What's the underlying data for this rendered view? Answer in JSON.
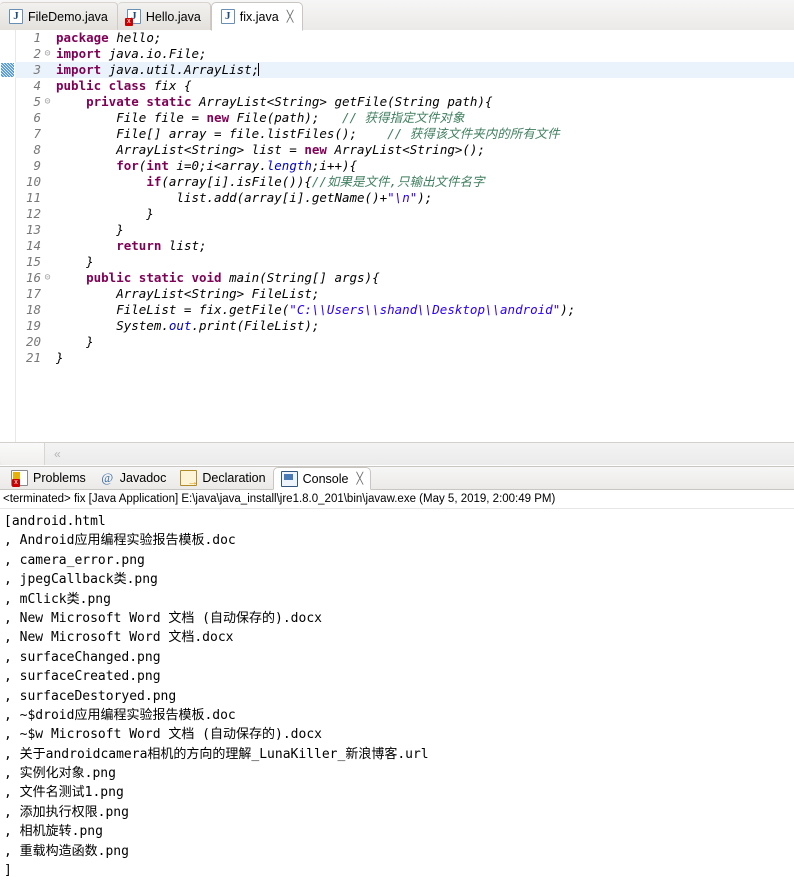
{
  "editor": {
    "tabs": [
      {
        "label": "FileDemo.java",
        "icon": "java-file-icon",
        "active": false,
        "error": false,
        "closeable": false
      },
      {
        "label": "Hello.java",
        "icon": "java-file-error-icon",
        "active": false,
        "error": true,
        "closeable": false
      },
      {
        "label": "fix.java",
        "icon": "java-file-icon",
        "active": true,
        "error": false,
        "closeable": true,
        "close_glyph": "╳"
      }
    ],
    "scroll_chevron": "«",
    "current_line": 3,
    "lines": [
      {
        "num": "1",
        "fold": false,
        "tokens": [
          {
            "t": "package ",
            "c": "kw"
          },
          {
            "t": "hello;",
            "c": "id"
          }
        ]
      },
      {
        "num": "2",
        "fold": true,
        "tokens": [
          {
            "t": "import ",
            "c": "kw"
          },
          {
            "t": "java.io.File;",
            "c": "id"
          }
        ]
      },
      {
        "num": "3",
        "fold": false,
        "tokens": [
          {
            "t": "import ",
            "c": "kw"
          },
          {
            "t": "java.util.ArrayList;",
            "c": "id"
          }
        ],
        "caret": true
      },
      {
        "num": "4",
        "fold": false,
        "tokens": [
          {
            "t": "public class ",
            "c": "kw"
          },
          {
            "t": "fix ",
            "c": "id"
          },
          {
            "t": "{",
            "c": "nrm"
          }
        ]
      },
      {
        "num": "5",
        "fold": true,
        "tokens": [
          {
            "t": "    ",
            "c": "nrm"
          },
          {
            "t": "private static ",
            "c": "kw"
          },
          {
            "t": "ArrayList<String> getFile(String path){",
            "c": "id"
          }
        ]
      },
      {
        "num": "6",
        "fold": false,
        "tokens": [
          {
            "t": "        File file = ",
            "c": "id"
          },
          {
            "t": "new ",
            "c": "kw"
          },
          {
            "t": "File(path);   ",
            "c": "id"
          },
          {
            "t": "// 获得指定文件对象",
            "c": "cmt"
          }
        ]
      },
      {
        "num": "7",
        "fold": false,
        "tokens": [
          {
            "t": "        File[] array = file.listFiles();    ",
            "c": "id"
          },
          {
            "t": "// 获得该文件夹内的所有文件",
            "c": "cmt"
          }
        ]
      },
      {
        "num": "8",
        "fold": false,
        "tokens": [
          {
            "t": "        ArrayList<String> list = ",
            "c": "id"
          },
          {
            "t": "new ",
            "c": "kw"
          },
          {
            "t": "ArrayList<String>();",
            "c": "id"
          }
        ]
      },
      {
        "num": "9",
        "fold": false,
        "tokens": [
          {
            "t": "        ",
            "c": "nrm"
          },
          {
            "t": "for",
            "c": "kw"
          },
          {
            "t": "(",
            "c": "id"
          },
          {
            "t": "int",
            "c": "kw"
          },
          {
            "t": " i=0;i<array.",
            "c": "id"
          },
          {
            "t": "length",
            "c": "fld"
          },
          {
            "t": ";i++){",
            "c": "id"
          }
        ]
      },
      {
        "num": "10",
        "fold": false,
        "tokens": [
          {
            "t": "            ",
            "c": "nrm"
          },
          {
            "t": "if",
            "c": "kw"
          },
          {
            "t": "(array[i].isFile()){",
            "c": "id"
          },
          {
            "t": "//如果是文件,只输出文件名字",
            "c": "cmt"
          }
        ]
      },
      {
        "num": "11",
        "fold": false,
        "tokens": [
          {
            "t": "                list.add(array[i].getName()+",
            "c": "id"
          },
          {
            "t": "\"\\n\"",
            "c": "str"
          },
          {
            "t": ");",
            "c": "id"
          }
        ]
      },
      {
        "num": "12",
        "fold": false,
        "tokens": [
          {
            "t": "            }",
            "c": "nrm"
          }
        ]
      },
      {
        "num": "13",
        "fold": false,
        "tokens": [
          {
            "t": "        }",
            "c": "nrm"
          }
        ]
      },
      {
        "num": "14",
        "fold": false,
        "tokens": [
          {
            "t": "        ",
            "c": "nrm"
          },
          {
            "t": "return ",
            "c": "kw"
          },
          {
            "t": "list;",
            "c": "id"
          }
        ]
      },
      {
        "num": "15",
        "fold": false,
        "tokens": [
          {
            "t": "    }",
            "c": "nrm"
          }
        ]
      },
      {
        "num": "16",
        "fold": true,
        "tokens": [
          {
            "t": "    ",
            "c": "nrm"
          },
          {
            "t": "public static void ",
            "c": "kw"
          },
          {
            "t": "main(String[] args){",
            "c": "id"
          }
        ]
      },
      {
        "num": "17",
        "fold": false,
        "tokens": [
          {
            "t": "        ArrayList<String> FileList;",
            "c": "id"
          }
        ]
      },
      {
        "num": "18",
        "fold": false,
        "tokens": [
          {
            "t": "        FileList = fix.getFile(",
            "c": "id"
          },
          {
            "t": "\"C:\\\\Users\\\\shand\\\\Desktop\\\\android\"",
            "c": "str"
          },
          {
            "t": ");",
            "c": "id"
          }
        ]
      },
      {
        "num": "19",
        "fold": false,
        "tokens": [
          {
            "t": "        System.",
            "c": "id"
          },
          {
            "t": "out",
            "c": "fld"
          },
          {
            "t": ".print(FileList);",
            "c": "id"
          }
        ]
      },
      {
        "num": "20",
        "fold": false,
        "tokens": [
          {
            "t": "    }",
            "c": "nrm"
          }
        ]
      },
      {
        "num": "21",
        "fold": false,
        "tokens": [
          {
            "t": "}",
            "c": "nrm"
          }
        ]
      }
    ]
  },
  "bottom_panel": {
    "tabs": [
      {
        "label": "Problems",
        "icon": "problems-icon",
        "active": false,
        "closeable": false
      },
      {
        "label": "Javadoc",
        "icon": "javadoc-icon",
        "active": false,
        "closeable": false,
        "glyph": "@"
      },
      {
        "label": "Declaration",
        "icon": "declaration-icon",
        "active": false,
        "closeable": false
      },
      {
        "label": "Console",
        "icon": "console-icon",
        "active": true,
        "closeable": true,
        "close_glyph": "╳"
      }
    ],
    "console": {
      "status_line": "<terminated> fix [Java Application] E:\\java\\java_install\\jre1.8.0_201\\bin\\javaw.exe (May 5, 2019, 2:00:49 PM)",
      "output_lines": [
        "[android.html",
        ", Android应用编程实验报告模板.doc",
        ", camera_error.png",
        ", jpegCallback类.png",
        ", mClick类.png",
        ", New Microsoft Word 文档 (自动保存的).docx",
        ", New Microsoft Word 文档.docx",
        ", surfaceChanged.png",
        ", surfaceCreated.png",
        ", surfaceDestoryed.png",
        ", ~$droid应用编程实验报告模板.doc",
        ", ~$w Microsoft Word 文档 (自动保存的).docx",
        ", 关于androidcamera相机的方向的理解_LunaKiller_新浪博客.url",
        ", 实例化对象.png",
        ", 文件名测试1.png",
        ", 添加执行权限.png",
        ", 相机旋转.png",
        ", 重载构造函数.png",
        "]"
      ]
    }
  },
  "colors": {
    "keyword": "#7F0055",
    "string": "#2A00FF",
    "comment": "#3F7F5F",
    "field": "#0000C0",
    "current_line_highlight": "#EAF2FB",
    "tab_active_bg": "#FFFFFF",
    "chrome_bg": "#ECEAE8"
  }
}
